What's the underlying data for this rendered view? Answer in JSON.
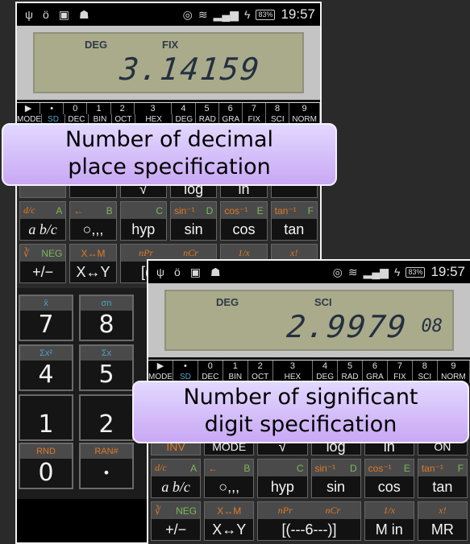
{
  "status_bar": {
    "left_icons": [
      "usb-icon",
      "lightbulb-icon",
      "image-icon",
      "android-icon"
    ],
    "right_icons": [
      "alarm-icon",
      "wifi-icon",
      "signal-icon",
      "charging-icon"
    ],
    "battery": "83%",
    "time": "19:57"
  },
  "screens": [
    {
      "display": {
        "angle": "DEG",
        "mode": "FIX",
        "value": "3.14159",
        "exponent": ""
      },
      "callout": [
        "Number of decimal",
        "place specification"
      ]
    },
    {
      "display": {
        "angle": "DEG",
        "mode": "SCI",
        "value": "2.9979",
        "exponent": "08"
      },
      "callout": [
        "Number of significant",
        "digit specification"
      ]
    }
  ],
  "mode_keys": {
    "top": [
      "▶",
      "•",
      "0",
      "1",
      "2",
      "3",
      "4",
      "5",
      "6",
      "7",
      "8",
      "9"
    ],
    "bottom": [
      "MODE",
      "SD",
      "DEC",
      "BIN",
      "OCT",
      "HEX",
      "DEG",
      "RAD",
      "GRA",
      "FIX",
      "SCI",
      "NORM"
    ]
  },
  "keys": {
    "row0": [
      "INV",
      "MODE",
      "√",
      "log",
      "ln",
      "ON"
    ],
    "row1": [
      {
        "shift": "d/c",
        "hex": "A",
        "main": "a b/c"
      },
      {
        "shift": "←",
        "hex": "B",
        "main": "○,,,"
      },
      {
        "shift": "",
        "hex": "C",
        "main": "hyp"
      },
      {
        "shift": "sin⁻¹",
        "hex": "D",
        "main": "sin"
      },
      {
        "shift": "cos⁻¹",
        "hex": "E",
        "main": "cos"
      },
      {
        "shift": "tan⁻¹",
        "hex": "F",
        "main": "tan"
      }
    ],
    "row2": [
      {
        "shift": "∛",
        "hex": "NEG",
        "main": "+/−"
      },
      {
        "shift": "X↔M",
        "hex": "",
        "main": "X↔Y"
      },
      {
        "shift": "nPr",
        "hex": "",
        "main": "[(---6---)]"
      },
      {
        "shift": "nCr",
        "hex": "",
        "main": ""
      },
      {
        "shift": "1/x",
        "hex": "",
        "main": "M in"
      },
      {
        "shift": "x!",
        "hex": "",
        "main": "MR"
      }
    ]
  },
  "numpad": [
    {
      "shift": "x̄",
      "main": "7"
    },
    {
      "shift": "σn",
      "main": "8"
    },
    {
      "shift": "Σx²",
      "main": "4"
    },
    {
      "shift": "Σx",
      "main": "5"
    },
    {
      "shift": "",
      "main": "1"
    },
    {
      "shift": "",
      "main": "2"
    },
    {
      "shift": "RND",
      "main": "0"
    },
    {
      "shift": "RAN#",
      "main": "•"
    }
  ],
  "nav": {
    "back_icon": "↩"
  }
}
